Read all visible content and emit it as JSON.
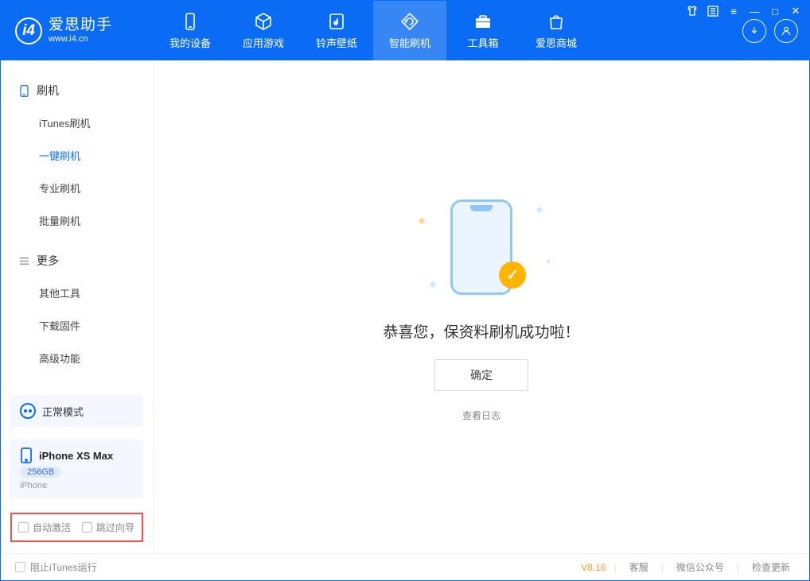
{
  "app": {
    "title": "爱思助手",
    "url": "www.i4.cn"
  },
  "tabs": {
    "device": "我的设备",
    "apps": "应用游戏",
    "ringtones": "铃声壁纸",
    "flash": "智能刷机",
    "toolbox": "工具箱",
    "store": "爱思商城"
  },
  "sidebar": {
    "section_flash": "刷机",
    "items_flash": {
      "itunes": "iTunes刷机",
      "oneclick": "一键刷机",
      "pro": "专业刷机",
      "batch": "批量刷机"
    },
    "section_more": "更多",
    "items_more": {
      "other": "其他工具",
      "firmware": "下载固件",
      "advanced": "高级功能"
    },
    "mode": "正常模式",
    "device": {
      "name": "iPhone XS Max",
      "storage": "256GB",
      "type": "iPhone"
    },
    "options": {
      "autoactivate": "自动激活",
      "skipguide": "跳过向导"
    }
  },
  "main": {
    "success": "恭喜您，保资料刷机成功啦！",
    "confirm": "确定",
    "viewlog": "查看日志"
  },
  "statusbar": {
    "blockitunes": "阻止iTunes运行",
    "version": "V8.16",
    "support": "客服",
    "wechat": "微信公众号",
    "update": "检查更新"
  }
}
